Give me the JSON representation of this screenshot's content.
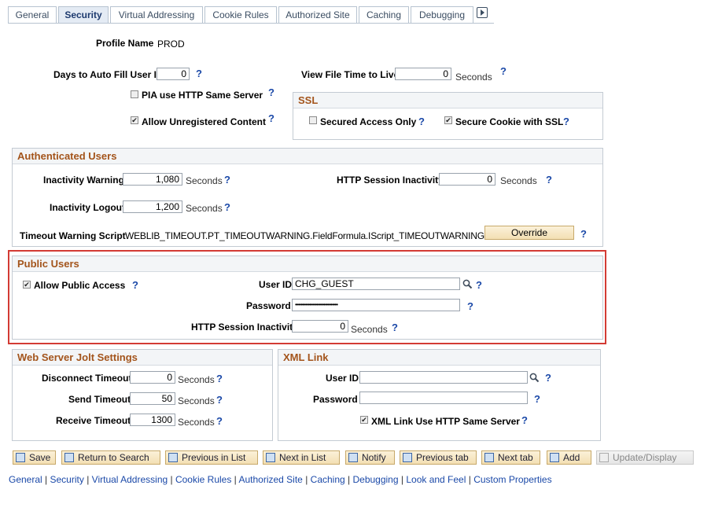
{
  "tabs": [
    "General",
    "Security",
    "Virtual Addressing",
    "Cookie Rules",
    "Authorized Site",
    "Caching",
    "Debugging"
  ],
  "active_tab": "Security",
  "help_glyph": "?",
  "profile": {
    "label": "Profile Name",
    "value": "PROD"
  },
  "days_autofill": {
    "label": "Days to Auto Fill User ID",
    "value": "0"
  },
  "view_file_ttl": {
    "label": "View File Time to Live",
    "value": "0",
    "units": "Seconds"
  },
  "pia_http_same_server": {
    "label": "PIA use HTTP Same Server",
    "checked": false
  },
  "allow_unregistered": {
    "label": "Allow Unregistered Content",
    "checked": true
  },
  "ssl": {
    "title": "SSL",
    "secured_access_only": {
      "label": "Secured Access Only",
      "checked": false
    },
    "secure_cookie": {
      "label": "Secure Cookie with SSL",
      "checked": true
    }
  },
  "auth_users": {
    "title": "Authenticated Users",
    "inactivity_warning": {
      "label": "Inactivity Warning",
      "value": "1,080",
      "units": "Seconds"
    },
    "inactivity_logout": {
      "label": "Inactivity Logout",
      "value": "1,200",
      "units": "Seconds"
    },
    "http_session_inactivity": {
      "label": "HTTP Session Inactivity",
      "value": "0",
      "units": "Seconds"
    },
    "timeout_script": {
      "label": "Timeout Warning Script",
      "value": "WEBLIB_TIMEOUT.PT_TIMEOUTWARNING.FieldFormula.IScript_TIMEOUTWARNING"
    },
    "override_label": "Override"
  },
  "public_users": {
    "title": "Public Users",
    "allow_public_access": {
      "label": "Allow Public Access",
      "checked": true
    },
    "user_id": {
      "label": "User ID",
      "value": "CHG_GUEST"
    },
    "password": {
      "label": "Password",
      "value": "••••••••••••••••••••••••••••••"
    },
    "http_session_inactivity": {
      "label": "HTTP Session Inactivity",
      "value": "0",
      "units": "Seconds"
    }
  },
  "jolt": {
    "title": "Web Server Jolt Settings",
    "disconnect_timeout": {
      "label": "Disconnect Timeout",
      "value": "0",
      "units": "Seconds"
    },
    "send_timeout": {
      "label": "Send Timeout",
      "value": "50",
      "units": "Seconds"
    },
    "receive_timeout": {
      "label": "Receive Timeout",
      "value": "1300",
      "units": "Seconds"
    }
  },
  "xml_link": {
    "title": "XML Link",
    "user_id": {
      "label": "User ID",
      "value": ""
    },
    "password": {
      "label": "Password",
      "value": ""
    },
    "use_http_same_server": {
      "label": "XML Link Use HTTP Same Server",
      "checked": true
    }
  },
  "toolbar": {
    "save": "Save",
    "return_to_search": "Return to Search",
    "previous_in_list": "Previous in List",
    "next_in_list": "Next in List",
    "notify": "Notify",
    "previous_tab": "Previous tab",
    "next_tab": "Next tab",
    "add": "Add",
    "update_display": "Update/Display"
  },
  "footer_links": [
    "General",
    "Security",
    "Virtual Addressing",
    "Cookie Rules",
    "Authorized Site",
    "Caching",
    "Debugging",
    "Look and Feel",
    "Custom Properties"
  ],
  "colors": {
    "section_title": "#a3541b",
    "help": "#1b49a8",
    "highlight_border": "#d33b34"
  }
}
